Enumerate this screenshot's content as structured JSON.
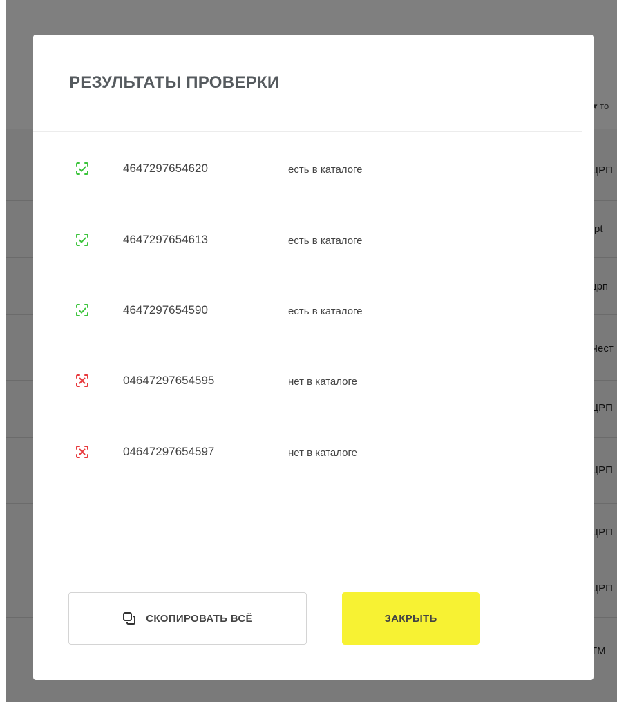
{
  "modal": {
    "title": "РЕЗУЛЬТАТЫ ПРОВЕРКИ",
    "results": [
      {
        "code": "4647297654620",
        "status": "есть в каталоге",
        "icon": "check-icon",
        "state": "found"
      },
      {
        "code": "4647297654613",
        "status": "есть в каталоге",
        "icon": "check-icon",
        "state": "found"
      },
      {
        "code": "4647297654590",
        "status": "есть в каталоге",
        "icon": "check-icon",
        "state": "found"
      },
      {
        "code": "04647297654595",
        "status": "нет в каталоге",
        "icon": "cross-icon",
        "state": "not-found"
      },
      {
        "code": "04647297654597",
        "status": "нет в каталоге",
        "icon": "cross-icon",
        "state": "not-found"
      }
    ],
    "copy_button": {
      "label": "СКОПИРОВАТЬ ВСЁ",
      "icon": "copy-icon"
    },
    "close_button": {
      "label": "ЗАКРЫТЬ"
    }
  },
  "background": {
    "column_header": "▾ то",
    "cells": [
      "ЦРП",
      "rpt",
      "црп",
      "Чест",
      "ЦРП",
      "ЦРП",
      "ЦРП",
      "ЦРП",
      "ТМ"
    ]
  },
  "colors": {
    "success": "#3cc43c",
    "error": "#e8393d",
    "accent": "#f7f233",
    "title": "#555a5e"
  }
}
